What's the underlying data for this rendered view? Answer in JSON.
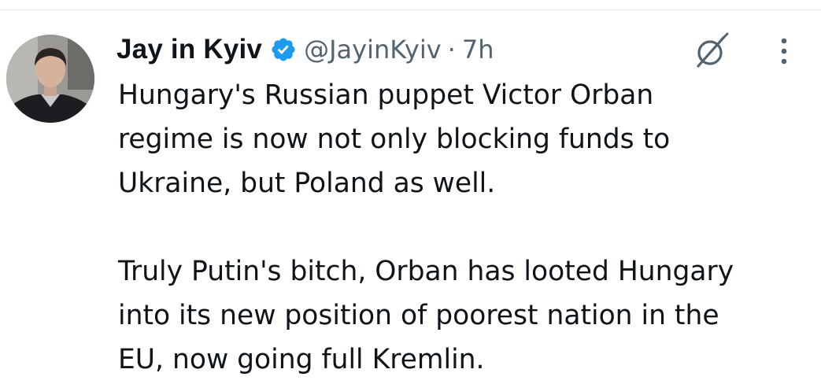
{
  "tweet": {
    "author": {
      "display_name": "Jay in Kyiv",
      "handle": "@JayinKyiv",
      "verified_icon": "verified-badge-icon",
      "avatar_icon": "avatar"
    },
    "separator": "·",
    "time": "7h",
    "actions": {
      "grok_icon": "grok-icon",
      "more_icon": "more-vertical-icon"
    },
    "paragraphs": [
      "Hungary's Russian puppet Victor Orban\nregime is now not only blocking funds to\nUkraine, but Poland as well.",
      "Truly Putin's bitch, Orban has looted Hungary\ninto its new position of poorest nation in the\nEU, now going full Kremlin."
    ]
  },
  "colors": {
    "text": "#0f1419",
    "secondary": "#536471",
    "verified": "#1d9bf0",
    "divider": "#e6e6e6"
  }
}
